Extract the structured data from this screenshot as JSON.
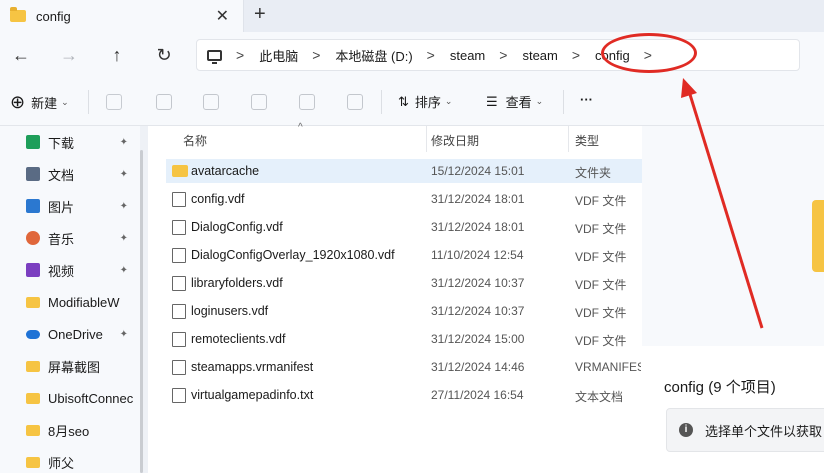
{
  "tab": {
    "title": "config",
    "close_glyph": "✕",
    "add_glyph": "+"
  },
  "nav": {
    "back": "←",
    "forward": "→",
    "up": "↑",
    "refresh": "↻"
  },
  "breadcrumb": [
    "此电脑",
    "本地磁盘 (D:)",
    "steam",
    "steam",
    "config"
  ],
  "breadcrumb_sep": ">",
  "toolbar": {
    "new_label": "新建",
    "sort_label": "排序",
    "view_label": "查看",
    "more_label": "···"
  },
  "sidebar": {
    "items": [
      {
        "label": "下载",
        "icon": "download-icon",
        "color": "#1e9e5a",
        "pinned": true
      },
      {
        "label": "文档",
        "icon": "document-icon",
        "color": "#5a6b84",
        "pinned": true
      },
      {
        "label": "图片",
        "icon": "picture-icon",
        "color": "#2b78d0",
        "pinned": true
      },
      {
        "label": "音乐",
        "icon": "music-icon",
        "color": "#e0673b",
        "pinned": true
      },
      {
        "label": "视频",
        "icon": "video-icon",
        "color": "#7b3fc0",
        "pinned": true
      },
      {
        "label": "ModifiableW",
        "icon": "folder-icon",
        "color": "#f6c443",
        "pinned": true
      },
      {
        "label": "OneDrive",
        "icon": "onedrive-icon",
        "color": "#1f73d6",
        "pinned": true
      },
      {
        "label": "屏幕截图",
        "icon": "folder-icon",
        "color": "#f6c443",
        "pinned": false
      },
      {
        "label": "UbisoftConnec",
        "icon": "folder-icon",
        "color": "#f6c443",
        "pinned": false
      },
      {
        "label": "8月seo",
        "icon": "folder-icon",
        "color": "#f6c443",
        "pinned": false
      },
      {
        "label": "师父",
        "icon": "folder-icon",
        "color": "#f6c443",
        "pinned": false
      }
    ],
    "pin_glyph": "📌"
  },
  "columns": {
    "name": "名称",
    "modified": "修改日期",
    "type": "类型"
  },
  "files": [
    {
      "name": "avatarcache",
      "date": "15/12/2024 15:01",
      "type": "文件夹",
      "folder": true
    },
    {
      "name": "config.vdf",
      "date": "31/12/2024 18:01",
      "type": "VDF 文件",
      "folder": false
    },
    {
      "name": "DialogConfig.vdf",
      "date": "31/12/2024 18:01",
      "type": "VDF 文件",
      "folder": false
    },
    {
      "name": "DialogConfigOverlay_1920x1080.vdf",
      "date": "11/10/2024 12:54",
      "type": "VDF 文件",
      "folder": false
    },
    {
      "name": "libraryfolders.vdf",
      "date": "31/12/2024 10:37",
      "type": "VDF 文件",
      "folder": false
    },
    {
      "name": "loginusers.vdf",
      "date": "31/12/2024 10:37",
      "type": "VDF 文件",
      "folder": false
    },
    {
      "name": "remoteclients.vdf",
      "date": "31/12/2024 15:00",
      "type": "VDF 文件",
      "folder": false
    },
    {
      "name": "steamapps.vrmanifest",
      "date": "31/12/2024 14:46",
      "type": "VRMANIFEST",
      "folder": false
    },
    {
      "name": "virtualgamepadinfo.txt",
      "date": "27/11/2024 16:54",
      "type": "文本文档",
      "folder": false
    }
  ],
  "details": {
    "title": "config (9 个项目)",
    "info": "选择单个文件以获取"
  },
  "colors": {
    "accent": "#e02b24",
    "folder": "#f6c443",
    "selection": "#e5f0fb"
  }
}
